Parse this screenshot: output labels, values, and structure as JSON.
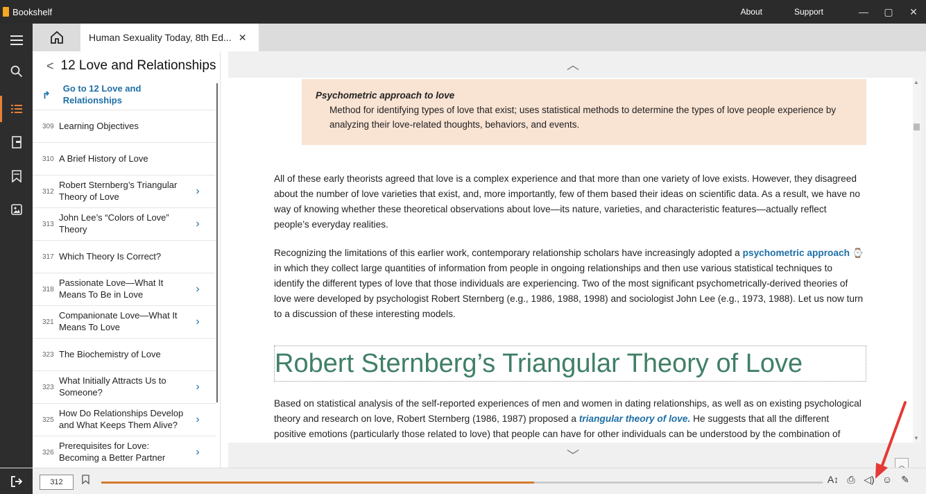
{
  "window": {
    "app_title": "Bookshelf",
    "about": "About",
    "support": "Support",
    "minimize": "—",
    "maximize": "▢",
    "close": "✕"
  },
  "rail": {
    "icons": [
      "menu-icon",
      "search-icon",
      "toc-icon",
      "page-icon",
      "bookmark-icon",
      "media-icon"
    ]
  },
  "tab": {
    "title": "Human Sexuality Today, 8th Ed...",
    "close": "✕"
  },
  "toc": {
    "header": "12 Love and Relationships",
    "goto": "Go to 12 Love and Relationships",
    "items": [
      {
        "page": "309",
        "label": "Learning Objectives",
        "expandable": false
      },
      {
        "page": "310",
        "label": "A Brief History of Love",
        "expandable": false
      },
      {
        "page": "312",
        "label": "Robert Sternberg’s Triangular Theory of Love",
        "expandable": true
      },
      {
        "page": "313",
        "label": "John Lee’s “Colors of Love” Theory",
        "expandable": true
      },
      {
        "page": "317",
        "label": "Which Theory Is Correct?",
        "expandable": false
      },
      {
        "page": "318",
        "label": "Passionate Love—What It Means To Be in Love",
        "expandable": true
      },
      {
        "page": "321",
        "label": "Companionate Love—What It Means To Love",
        "expandable": true
      },
      {
        "page": "323",
        "label": "The Biochemistry of Love",
        "expandable": false
      },
      {
        "page": "323",
        "label": "What Initially Attracts Us to Someone?",
        "expandable": true
      },
      {
        "page": "325",
        "label": "How Do Relationships Develop and What Keeps Them Alive?",
        "expandable": true
      },
      {
        "page": "326",
        "label": "Prerequisites for Love: Becoming a Better Partner",
        "expandable": true
      }
    ]
  },
  "content": {
    "definition_term": "Psychometric approach to love",
    "definition_text": "Method for identifying types of love that exist; uses statistical methods to determine the types of love people experience by analyzing their love-related thoughts, behaviors, and events.",
    "para1": "All of these early theorists agreed that love is a complex experience and that more than one variety of love exists. However, they disagreed about the number of love varieties that exist, and, more importantly, few of them based their ideas on scientific data. As a result, we have no way of knowing whether these theoretical observations about love—its nature, varieties, and characteristic features—actually reflect people’s everyday realities.",
    "para2_pre": "Recognizing the limitations of this earlier work, contemporary relationship scholars have increasingly adopted a ",
    "para2_kw": "psychometric approach",
    "para2_post": " in which they collect large quantities of information from people in ongoing relationships and then use various statistical techniques to identify the different types of love that those individuals are experiencing. Two of the most significant psychometrically-derived theories of love were developed by psychologist Robert Sternberg (e.g., 1986, 1988, 1998) and sociologist John Lee (e.g., 1973, 1988). Let us now turn to a discussion of these interesting models.",
    "heading": "Robert Sternberg’s Triangular Theory of Love",
    "para3_pre": "Based on statistical analysis of the self-reported experiences of men and women in dating relationships, as well as on existing psychological theory and research on love, Robert Sternberg (1986, 1987) proposed a ",
    "para3_kw": "triangular theory of love.",
    "para3_post": " He suggests that all the different positive emotions (particularly those related to love) that people can have for other individuals can be understood by the combination of three basic components that form the vertices of a triangle, as shown in Figure 12.3. The triangle should not be taken as a geometric model, but"
  },
  "bottom": {
    "page_number": "312",
    "progress_fraction": 0.6,
    "tools": [
      "text-size-icon",
      "print-icon",
      "read-aloud-icon",
      "feedback-icon",
      "notes-icon"
    ]
  },
  "colors": {
    "accent": "#e8803a",
    "link": "#1e6fa6",
    "heading": "#3f7f66",
    "definition_bg": "#f9e3d3",
    "annotation_arrow": "#e53935"
  }
}
